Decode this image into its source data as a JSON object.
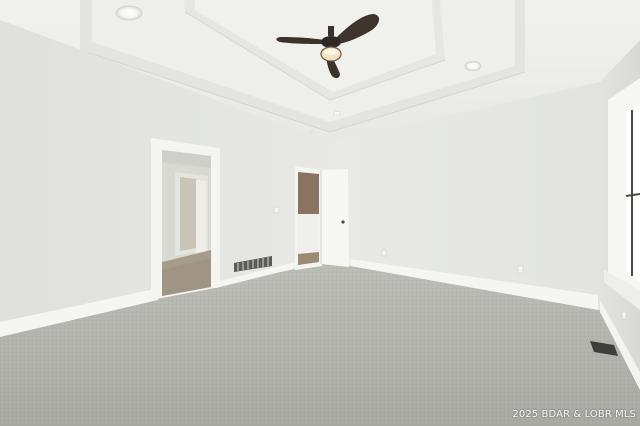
{
  "photo": {
    "watermark": "2025 BDAR & LOBR MLS"
  },
  "colors": {
    "wall": "#e6e7e2",
    "ceiling": "#edeeea",
    "carpet": "#b3b3ae",
    "trim": "#f7f7f4",
    "fan": "#3a322c"
  },
  "icons": [
    "ceiling-fan-icon",
    "recessed-light-icon",
    "floor-vent-icon"
  ]
}
